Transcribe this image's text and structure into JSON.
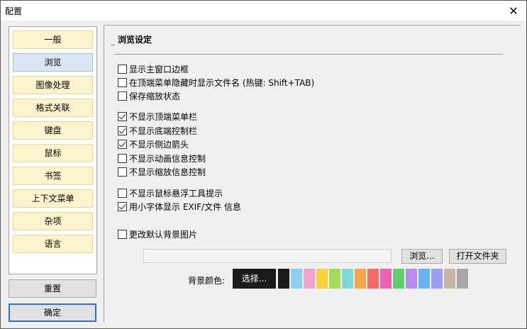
{
  "window": {
    "title": "配置",
    "close_glyph": "✕"
  },
  "nav": {
    "items": [
      {
        "label": "一般",
        "selected": false
      },
      {
        "label": "浏览",
        "selected": true
      },
      {
        "label": "图像处理",
        "selected": false
      },
      {
        "label": "格式关联",
        "selected": false
      },
      {
        "label": "键盘",
        "selected": false
      },
      {
        "label": "鼠标",
        "selected": false
      },
      {
        "label": "书签",
        "selected": false
      },
      {
        "label": "上下文菜单",
        "selected": false
      },
      {
        "label": "杂项",
        "selected": false
      },
      {
        "label": "语言",
        "selected": false
      }
    ],
    "reset_label": "重置",
    "ok_label": "确定"
  },
  "content": {
    "section_title": "浏览设定",
    "options": [
      {
        "label": "显示主窗口边框",
        "checked": false
      },
      {
        "label": "在顶端菜单隐藏时显示文件名 (热键: Shift+TAB)",
        "checked": false
      },
      {
        "label": "保存缩放状态",
        "checked": false
      },
      {
        "label": "不显示顶端菜单栏",
        "checked": true
      },
      {
        "label": "不显示底端控制栏",
        "checked": true
      },
      {
        "label": "不显示侧边箭头",
        "checked": true
      },
      {
        "label": "不显示动画信息控制",
        "checked": false
      },
      {
        "label": "不显示缩放信息控制",
        "checked": false
      },
      {
        "label": "不显示鼠标悬浮工具提示",
        "checked": false
      },
      {
        "label": "用小字体显示 EXIF/文件 信息",
        "checked": true
      },
      {
        "label": "更改默认背景图片",
        "checked": false
      }
    ],
    "bg_image_path": "",
    "browse_label": "浏览...",
    "open_folder_label": "打开文件夹",
    "bg_color_label": "背景颜色:",
    "choose_label": "选择...",
    "swatch_colors": [
      "#1b1b1b",
      "#8ccff0",
      "#f2a2cf",
      "#f7d23a",
      "#a7d95a",
      "#7fdad6",
      "#f6a64a",
      "#f46c6a",
      "#ef64b2",
      "#5fcf6e",
      "#bb8cf0",
      "#66b3f6",
      "#9c9ef0",
      "#c8b6a6",
      "#a8a8a8"
    ]
  }
}
